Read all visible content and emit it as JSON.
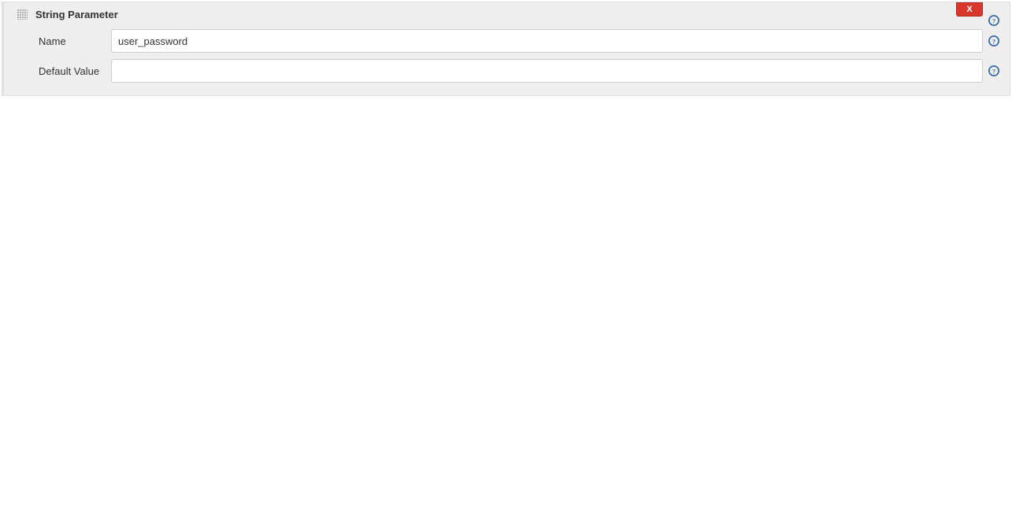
{
  "parameter": {
    "type_label": "String Parameter",
    "delete_label": "X",
    "fields": {
      "name": {
        "label": "Name",
        "value": "user_password"
      },
      "default_value": {
        "label": "Default Value",
        "value": ""
      }
    }
  }
}
